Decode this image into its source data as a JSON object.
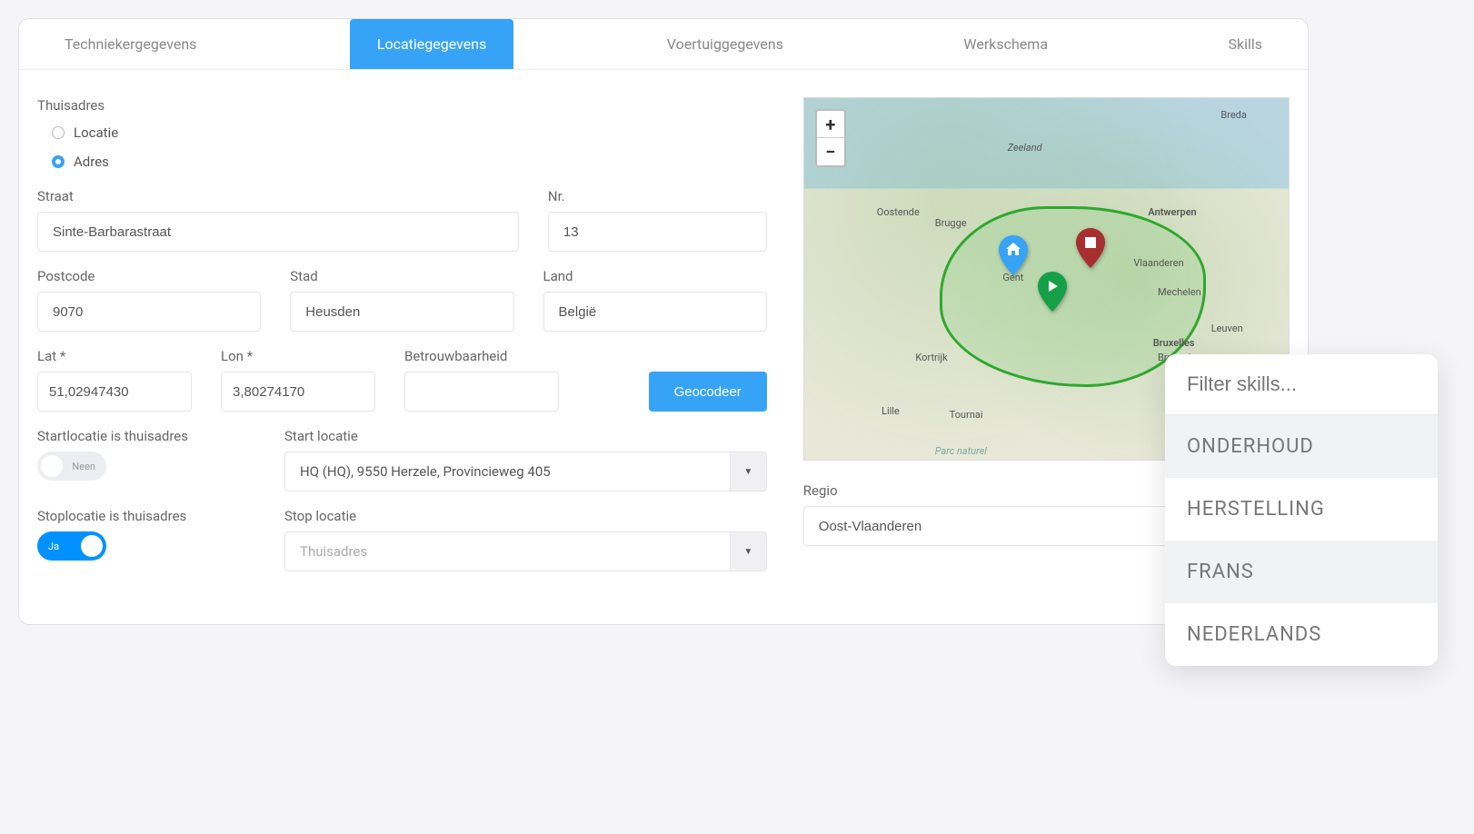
{
  "tabs": {
    "technieker": "Techniekergegevens",
    "locatie": "Locatiegegevens",
    "voertuig": "Voertuiggegevens",
    "werkschema": "Werkschema",
    "skills": "Skills"
  },
  "home": {
    "section_label": "Thuisadres",
    "radio_locatie": "Locatie",
    "radio_adres": "Adres"
  },
  "labels": {
    "straat": "Straat",
    "nr": "Nr.",
    "postcode": "Postcode",
    "stad": "Stad",
    "land": "Land",
    "lat": "Lat *",
    "lon": "Lon *",
    "betrouwbaarheid": "Betrouwbaarheid",
    "geocodeer": "Geocodeer",
    "start_is_home": "Startlocatie is thuisadres",
    "start_locatie": "Start locatie",
    "stop_is_home": "Stoplocatie is thuisadres",
    "stop_locatie": "Stop locatie",
    "regio": "Regio"
  },
  "values": {
    "straat": "Sinte-Barbarastraat",
    "nr": "13",
    "postcode": "9070",
    "stad": "Heusden",
    "land": "België",
    "lat": "51,02947430",
    "lon": "3,80274170",
    "betrouwbaarheid": "",
    "start_is_home": "Neen",
    "start_locatie": "HQ (HQ), 9550 Herzele, Provincieweg 405",
    "stop_is_home": "Ja",
    "stop_locatie": "Thuisadres",
    "regio": "Oost-Vlaanderen"
  },
  "map": {
    "zoom_in": "+",
    "zoom_out": "−",
    "cities": {
      "breda": "Breda",
      "zeeland": "Zeeland",
      "oostende": "Oostende",
      "brugge": "Brugge",
      "gent": "Gent",
      "antwerpen": "Antwerpen",
      "mechelen": "Mechelen",
      "leuven": "Leuven",
      "bruxelles": "Bruxelles",
      "brussel": "Brussel",
      "kortrijk": "Kortrijk",
      "lille": "Lille",
      "tournai": "Tournai",
      "vlaanderen": "Vlaanderen",
      "parc": "Parc naturel"
    }
  },
  "skills": {
    "filter_placeholder": "Filter skills...",
    "items": {
      "onderhoud": "ONDERHOUD",
      "herstelling": "HERSTELLING",
      "frans": "FRANS",
      "nederlands": "NEDERLANDS"
    }
  }
}
